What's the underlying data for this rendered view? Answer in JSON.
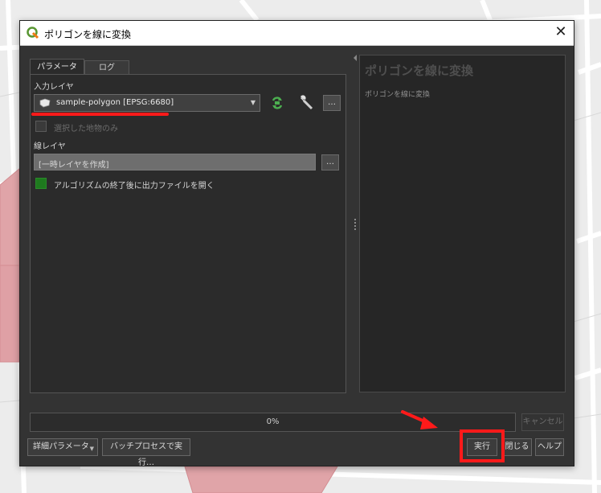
{
  "window": {
    "title": "ポリゴンを線に変換"
  },
  "tabs": [
    {
      "label": "パラメータ",
      "active": true
    },
    {
      "label": "ログ",
      "active": false
    }
  ],
  "params": {
    "input_layer_label": "入力レイヤ",
    "input_layer_value": "sample-polygon [EPSG:6680]",
    "selected_only_label": "選択した地物のみ",
    "line_layer_label": "線レイヤ",
    "line_layer_value": "[一時レイヤを作成]",
    "open_output_label": "アルゴリズムの終了後に出力ファイルを開く",
    "ellipsis": "…"
  },
  "help": {
    "title": "ポリゴンを線に変換",
    "body": "ポリゴンを線に変換"
  },
  "progress": {
    "text": "0%",
    "value": 0
  },
  "buttons": {
    "cancel": "キャンセル",
    "advanced": "詳細パラメータ",
    "batch": "バッチプロセスで実行…",
    "run": "実行",
    "close": "閉じる",
    "help": "ヘルプ"
  },
  "colors": {
    "annotation": "#ff1a1a",
    "accent_green": "#4caf50",
    "checkbox_checked": "#1e7a1e"
  },
  "icons": [
    "qgis-logo-icon",
    "close-icon",
    "polygon-layer-icon",
    "iterate-icon",
    "wrench-icon",
    "chevron-down-icon",
    "splitter-handle-icon",
    "arrow-icon"
  ]
}
